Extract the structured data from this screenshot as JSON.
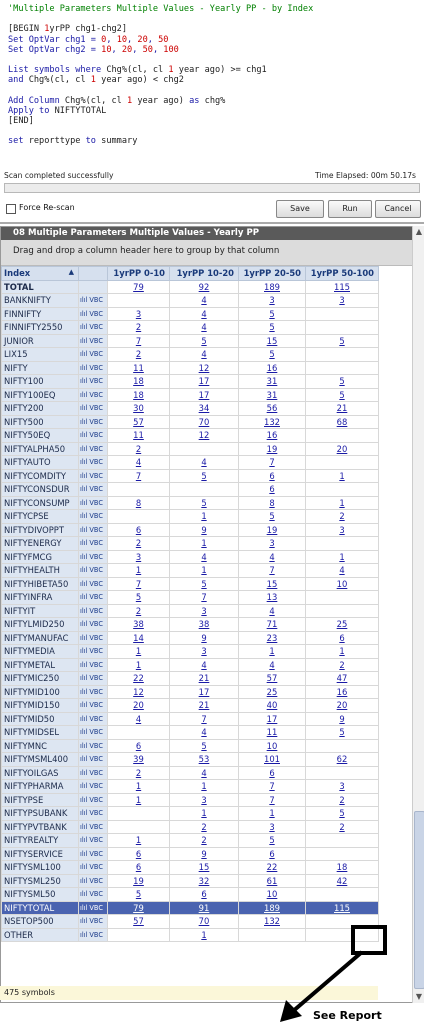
{
  "script_lines": [
    [
      [
        "c-com",
        "'Multiple Parameters Multiple Values - Yearly PP - by Index"
      ]
    ],
    [
      [
        "c-blk",
        ""
      ]
    ],
    [
      [
        "c-blk",
        "[BEGIN "
      ],
      [
        "c-num",
        "1"
      ],
      [
        "c-blk",
        "yrPP chg1-chg2]"
      ]
    ],
    [
      [
        "c-kw",
        "Set OptVar chg1 = "
      ],
      [
        "c-num",
        "0"
      ],
      [
        "c-kw",
        ", "
      ],
      [
        "c-num",
        "10"
      ],
      [
        "c-kw",
        ", "
      ],
      [
        "c-num",
        "20"
      ],
      [
        "c-kw",
        ", "
      ],
      [
        "c-num",
        "50"
      ]
    ],
    [
      [
        "c-kw",
        "Set OptVar chg2 = "
      ],
      [
        "c-num",
        "10"
      ],
      [
        "c-kw",
        ", "
      ],
      [
        "c-num",
        "20"
      ],
      [
        "c-kw",
        ", "
      ],
      [
        "c-num",
        "50"
      ],
      [
        "c-kw",
        ", "
      ],
      [
        "c-num",
        "100"
      ]
    ],
    [
      [
        "c-blk",
        ""
      ]
    ],
    [
      [
        "c-kw",
        "List symbols where "
      ],
      [
        "c-blk",
        "Chg%(cl, cl "
      ],
      [
        "c-num",
        "1"
      ],
      [
        "c-blk",
        " year ago) >= chg1"
      ]
    ],
    [
      [
        "c-kw",
        "and "
      ],
      [
        "c-blk",
        "Chg%(cl, cl "
      ],
      [
        "c-num",
        "1"
      ],
      [
        "c-blk",
        " year ago) < chg2"
      ]
    ],
    [
      [
        "c-blk",
        ""
      ]
    ],
    [
      [
        "c-kw",
        "Add Column "
      ],
      [
        "c-blk",
        "Chg%(cl, cl "
      ],
      [
        "c-num",
        "1"
      ],
      [
        "c-blk",
        " year ago) "
      ],
      [
        "c-kw",
        "as "
      ],
      [
        "c-blk",
        "chg%"
      ]
    ],
    [
      [
        "c-kw",
        "Apply to "
      ],
      [
        "c-blk",
        "NIFTYTOTAL"
      ]
    ],
    [
      [
        "c-blk",
        "[END]"
      ]
    ],
    [
      [
        "c-blk",
        ""
      ]
    ],
    [
      [
        "c-kw",
        "set "
      ],
      [
        "c-blk",
        "reporttype "
      ],
      [
        "c-kw",
        "to "
      ],
      [
        "c-blk",
        "summary"
      ]
    ]
  ],
  "status": {
    "message": "Scan completed successfully",
    "elapsed": "Time Elapsed: 00m 50.17s",
    "progress": 0
  },
  "options": {
    "force_rescan": "Force Re-scan",
    "force_rescan_checked": false,
    "save": "Save",
    "run": "Run",
    "cancel": "Cancel"
  },
  "grid": {
    "title": "08 Multiple Parameters Multiple Values - Yearly PP",
    "group_hint": "Drag and drop a column header here to group by that column",
    "columns": [
      "Index",
      "1yrPP 0-10",
      "1yrPP 10-20",
      "1yrPP 20-50",
      "1yrPP 50-100"
    ],
    "sort_indicator": "▲",
    "spark": "ılıl VBC",
    "rows": [
      {
        "name": "TOTAL",
        "v": [
          "79",
          "92",
          "189",
          "115"
        ],
        "bold": true
      },
      {
        "name": "BANKNIFTY",
        "v": [
          "",
          "4",
          "3",
          "3"
        ]
      },
      {
        "name": "FINNIFTY",
        "v": [
          "3",
          "4",
          "5",
          ""
        ]
      },
      {
        "name": "FINNIFTY2550",
        "v": [
          "2",
          "4",
          "5",
          ""
        ]
      },
      {
        "name": "JUNIOR",
        "v": [
          "7",
          "5",
          "15",
          "5"
        ]
      },
      {
        "name": "LIX15",
        "v": [
          "2",
          "4",
          "5",
          ""
        ]
      },
      {
        "name": "NIFTY",
        "v": [
          "11",
          "12",
          "16",
          ""
        ]
      },
      {
        "name": "NIFTY100",
        "v": [
          "18",
          "17",
          "31",
          "5"
        ]
      },
      {
        "name": "NIFTY100EQ",
        "v": [
          "18",
          "17",
          "31",
          "5"
        ]
      },
      {
        "name": "NIFTY200",
        "v": [
          "30",
          "34",
          "56",
          "21"
        ]
      },
      {
        "name": "NIFTY500",
        "v": [
          "57",
          "70",
          "132",
          "68"
        ]
      },
      {
        "name": "NIFTY50EQ",
        "v": [
          "11",
          "12",
          "16",
          ""
        ]
      },
      {
        "name": "NIFTYALPHA50",
        "v": [
          "2",
          "",
          "19",
          "20"
        ]
      },
      {
        "name": "NIFTYAUTO",
        "v": [
          "4",
          "4",
          "7",
          ""
        ]
      },
      {
        "name": "NIFTYCOMDITY",
        "v": [
          "7",
          "5",
          "6",
          "1"
        ]
      },
      {
        "name": "NIFTYCONSDUR",
        "v": [
          "",
          "",
          "6",
          ""
        ]
      },
      {
        "name": "NIFTYCONSUMP",
        "v": [
          "8",
          "5",
          "8",
          "1"
        ]
      },
      {
        "name": "NIFTYCPSE",
        "v": [
          "",
          "1",
          "5",
          "2"
        ]
      },
      {
        "name": "NIFTYDIVOPPT",
        "v": [
          "6",
          "9",
          "19",
          "3"
        ]
      },
      {
        "name": "NIFTYENERGY",
        "v": [
          "2",
          "1",
          "3",
          ""
        ]
      },
      {
        "name": "NIFTYFMCG",
        "v": [
          "3",
          "4",
          "4",
          "1"
        ]
      },
      {
        "name": "NIFTYHEALTH",
        "v": [
          "1",
          "1",
          "7",
          "4"
        ]
      },
      {
        "name": "NIFTYHIBETA50",
        "v": [
          "7",
          "5",
          "15",
          "10"
        ]
      },
      {
        "name": "NIFTYINFRA",
        "v": [
          "5",
          "7",
          "13",
          ""
        ]
      },
      {
        "name": "NIFTYIT",
        "v": [
          "2",
          "3",
          "4",
          ""
        ]
      },
      {
        "name": "NIFTYLMID250",
        "v": [
          "38",
          "38",
          "71",
          "25"
        ]
      },
      {
        "name": "NIFTYMANUFAC",
        "v": [
          "14",
          "9",
          "23",
          "6"
        ]
      },
      {
        "name": "NIFTYMEDIA",
        "v": [
          "1",
          "3",
          "1",
          "1"
        ]
      },
      {
        "name": "NIFTYMETAL",
        "v": [
          "1",
          "4",
          "4",
          "2"
        ]
      },
      {
        "name": "NIFTYMIC250",
        "v": [
          "22",
          "21",
          "57",
          "47"
        ]
      },
      {
        "name": "NIFTYMID100",
        "v": [
          "12",
          "17",
          "25",
          "16"
        ]
      },
      {
        "name": "NIFTYMID150",
        "v": [
          "20",
          "21",
          "40",
          "20"
        ]
      },
      {
        "name": "NIFTYMID50",
        "v": [
          "4",
          "7",
          "17",
          "9"
        ]
      },
      {
        "name": "NIFTYMIDSEL",
        "v": [
          "",
          "4",
          "11",
          "5"
        ]
      },
      {
        "name": "NIFTYMNC",
        "v": [
          "6",
          "5",
          "10",
          ""
        ]
      },
      {
        "name": "NIFTYMSML400",
        "v": [
          "39",
          "53",
          "101",
          "62"
        ]
      },
      {
        "name": "NIFTYOILGAS",
        "v": [
          "2",
          "4",
          "6",
          ""
        ]
      },
      {
        "name": "NIFTYPHARMA",
        "v": [
          "1",
          "1",
          "7",
          "3"
        ]
      },
      {
        "name": "NIFTYPSE",
        "v": [
          "1",
          "3",
          "7",
          "2"
        ]
      },
      {
        "name": "NIFTYPSUBANK",
        "v": [
          "",
          "1",
          "1",
          "5"
        ]
      },
      {
        "name": "NIFTYPVTBANK",
        "v": [
          "",
          "2",
          "3",
          "2"
        ]
      },
      {
        "name": "NIFTYREALTY",
        "v": [
          "1",
          "2",
          "5",
          ""
        ]
      },
      {
        "name": "NIFTYSERVICE",
        "v": [
          "6",
          "9",
          "6",
          ""
        ]
      },
      {
        "name": "NIFTYSML100",
        "v": [
          "6",
          "15",
          "22",
          "18"
        ]
      },
      {
        "name": "NIFTYSML250",
        "v": [
          "19",
          "32",
          "61",
          "42"
        ]
      },
      {
        "name": "NIFTYSML50",
        "v": [
          "5",
          "6",
          "10",
          ""
        ]
      },
      {
        "name": "NIFTYTOTAL",
        "v": [
          "79",
          "91",
          "189",
          "115"
        ],
        "selected": true
      },
      {
        "name": "NSETOP500",
        "v": [
          "57",
          "70",
          "132",
          ""
        ]
      },
      {
        "name": "OTHER",
        "v": [
          "",
          "1",
          "",
          ""
        ]
      }
    ]
  },
  "footer": "475 symbols",
  "annotation": "See Report",
  "colors": {
    "selected_row": "#4a63b0",
    "header_bg": "#d6e0ee",
    "title_bg": "#5a5a5a",
    "link": "#1a1aa6"
  }
}
